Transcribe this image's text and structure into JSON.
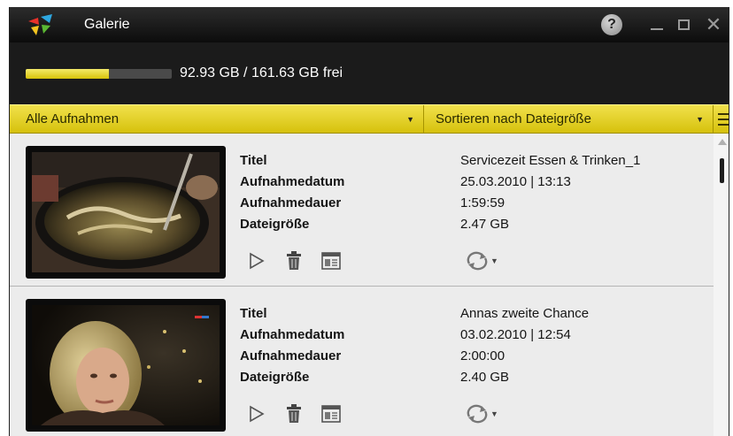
{
  "window": {
    "title": "Galerie"
  },
  "titlebar": {
    "help_label": "?",
    "close_label": "✕"
  },
  "storage": {
    "text": "92.93 GB / 161.63 GB frei",
    "fill_percent": 57,
    "accent_color": "#e6d21e"
  },
  "filterbar": {
    "filter_label": "Alle Aufnahmen",
    "sort_label": "Sortieren nach Dateigröße"
  },
  "fields": {
    "title": "Titel",
    "date": "Aufnahmedatum",
    "duration": "Aufnahmedauer",
    "size": "Dateigröße"
  },
  "recordings": [
    {
      "title": "Servicezeit Essen & Trinken_1",
      "date": "25.03.2010  |  13:13",
      "duration": "1:59:59",
      "size": "2.47 GB"
    },
    {
      "title": "Annas zweite Chance",
      "date": "03.02.2010  |  12:54",
      "duration": "2:00:00",
      "size": "2.40 GB"
    }
  ],
  "icons": {
    "logo": "app-logo",
    "play": "play-icon",
    "delete": "trash-icon",
    "details": "details-icon",
    "convert": "convert-icon"
  }
}
